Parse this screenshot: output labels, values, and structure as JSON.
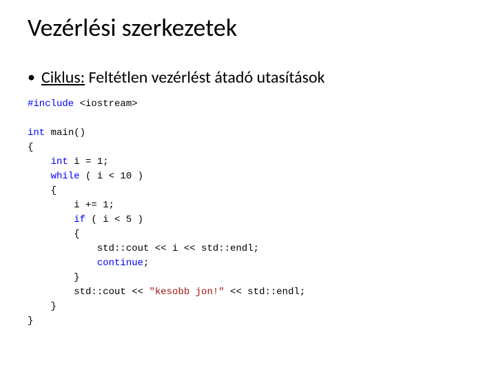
{
  "title": "Vezérlési szerkezetek",
  "bullet": {
    "label_underlined": "Ciklus:",
    "label_rest": " Feltétlen vezérlést átadó utasítások"
  },
  "code": {
    "l1_include": "#include",
    "l1_header": " <iostream>",
    "l3_int": "int",
    "l3_main": " main()",
    "l4": "{",
    "l5_int": "    int",
    "l5_rest": " i = 1;",
    "l6_while": "    while",
    "l6_rest": " ( i < 10 )",
    "l7": "    {",
    "l8": "        i += 1;",
    "l9_if": "        if",
    "l9_rest": " ( i < 5 )",
    "l10": "        {",
    "l11": "            std::cout << i << std::endl;",
    "l12_cont": "            continue",
    "l12_semi": ";",
    "l13": "        }",
    "l14_a": "        std::cout << ",
    "l14_str": "\"kesobb jon!\"",
    "l14_b": " << std::endl;",
    "l15": "    }",
    "l16": "}"
  }
}
